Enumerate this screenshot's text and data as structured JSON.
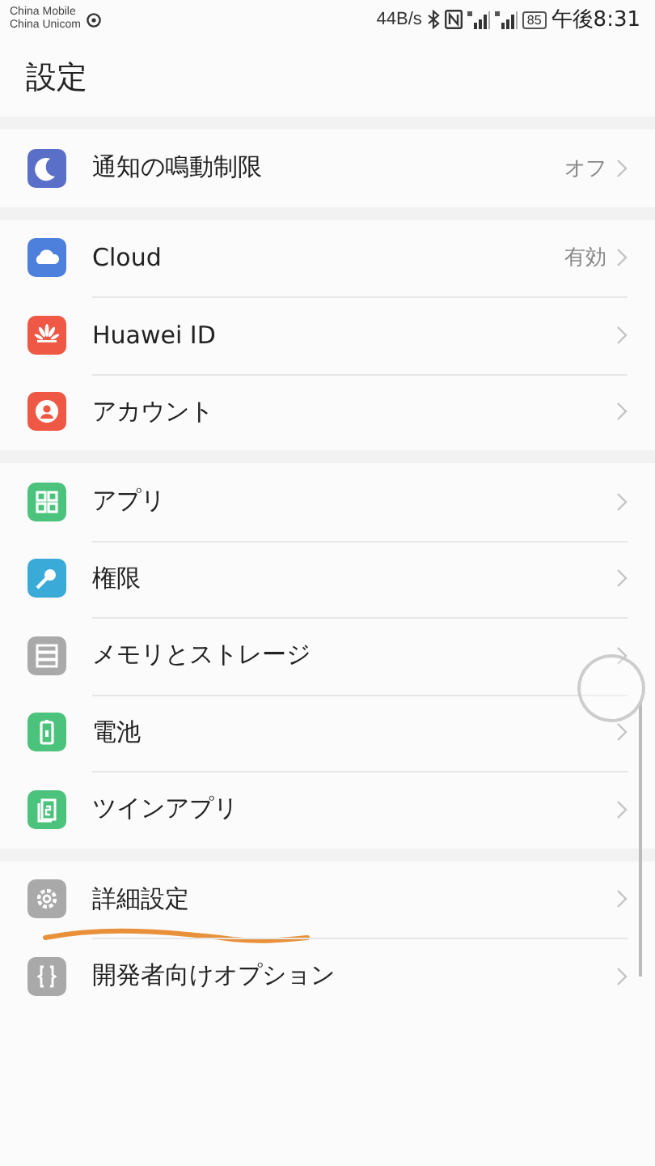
{
  "status_bar": {
    "carriers": [
      "China Mobile",
      "China Unicom"
    ],
    "speed": "44B/s",
    "battery": "85",
    "time": "午後8:31"
  },
  "title": "設定",
  "sections": [
    {
      "items": [
        {
          "kind": "moon",
          "label": "通知の鳴動制限",
          "value": "オフ"
        }
      ]
    },
    {
      "items": [
        {
          "kind": "cloud",
          "label": "Cloud",
          "value": "有効"
        },
        {
          "kind": "huawei",
          "label": "Huawei ID"
        },
        {
          "kind": "account",
          "label": "アカウント"
        }
      ]
    },
    {
      "items": [
        {
          "kind": "apps",
          "label": "アプリ"
        },
        {
          "kind": "key",
          "label": "権限"
        },
        {
          "kind": "storage",
          "label": "メモリとストレージ"
        },
        {
          "kind": "battery",
          "label": "電池"
        },
        {
          "kind": "twin",
          "label": "ツインアプリ"
        }
      ]
    },
    {
      "items": [
        {
          "kind": "gear",
          "label": "詳細設定",
          "underlined": true
        },
        {
          "kind": "braces",
          "label": "開発者向けオプション"
        }
      ]
    }
  ]
}
